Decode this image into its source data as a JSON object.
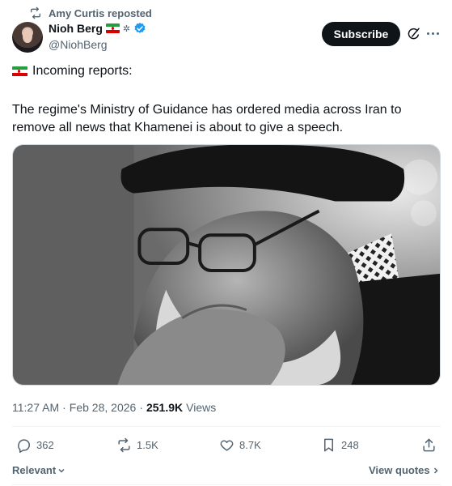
{
  "repost": {
    "label": "Amy Curtis reposted",
    "icon": "repost-icon"
  },
  "author": {
    "name": "Nioh Berg",
    "handle": "@NiohBerg",
    "badges": [
      "iran-flag",
      "gear-icon",
      "verified-badge-icon"
    ],
    "verified_color": "#1d9bf0"
  },
  "header": {
    "subscribe_label": "Subscribe",
    "grok_icon": "grok-icon",
    "more_icon": "more-icon"
  },
  "post": {
    "lead": "Incoming reports:",
    "text": "The regime's Ministry of Guidance has ordered media across Iran to remove all news that Khamenei is about to give a speech."
  },
  "meta": {
    "time": "11:27 AM",
    "separator": "·",
    "date": "Feb 28, 2026",
    "views_count": "251.9K",
    "views_label": "Views"
  },
  "actions": {
    "replies": "362",
    "reposts": "1.5K",
    "likes": "8.7K",
    "bookmarks": "248"
  },
  "footer": {
    "relevant_label": "Relevant",
    "view_quotes_label": "View quotes"
  },
  "colors": {
    "text": "#0f1419",
    "muted": "#536471",
    "button_bg": "#0f1419",
    "border": "#cfd9de"
  }
}
